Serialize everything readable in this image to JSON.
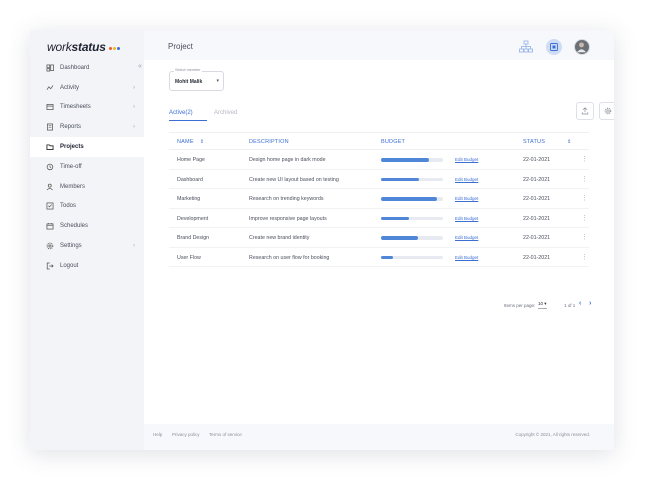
{
  "brand": {
    "name_light": "work",
    "name_bold": "status",
    "dot_colors": [
      "#f05a28",
      "#f7b718",
      "#3c6fd4"
    ]
  },
  "sidebar": {
    "items": [
      {
        "label": "Dashboard",
        "icon": "dashboard-icon",
        "active": false,
        "chevron": false
      },
      {
        "label": "Activity",
        "icon": "activity-icon",
        "active": false,
        "chevron": true
      },
      {
        "label": "Timesheets",
        "icon": "timesheet-icon",
        "active": false,
        "chevron": true
      },
      {
        "label": "Reports",
        "icon": "reports-icon",
        "active": false,
        "chevron": true
      },
      {
        "label": "Projects",
        "icon": "folder-icon",
        "active": true,
        "chevron": false
      },
      {
        "label": "Time-off",
        "icon": "history-icon",
        "active": false,
        "chevron": false
      },
      {
        "label": "Members",
        "icon": "members-icon",
        "active": false,
        "chevron": false
      },
      {
        "label": "Todos",
        "icon": "todo-icon",
        "active": false,
        "chevron": false
      },
      {
        "label": "Schedules",
        "icon": "calendar-icon",
        "active": false,
        "chevron": false
      },
      {
        "label": "Settings",
        "icon": "gear-icon",
        "active": false,
        "chevron": true
      },
      {
        "label": "Logout",
        "icon": "logout-icon",
        "active": false,
        "chevron": false
      }
    ],
    "collapse_glyph": "«"
  },
  "header": {
    "title": "Project"
  },
  "filter": {
    "label": "Select member",
    "value": "Mohit Malik"
  },
  "tabs": {
    "active": "Active(2)",
    "inactive": "Archived"
  },
  "table": {
    "headers": {
      "name": "NAME",
      "description": "DESCRIPTION",
      "budget": "BUDGET",
      "status": "STATUS"
    },
    "edit_label": "Edit Budget",
    "rows": [
      {
        "name": "Home Page",
        "description": "Design home page in dark mode",
        "budget": 0.78,
        "status": "22-01-2021"
      },
      {
        "name": "Dashboard",
        "description": "Create new UI layout based on testing",
        "budget": 0.62,
        "status": "22-01-2021"
      },
      {
        "name": "Marketing",
        "description": "Research on trending keywords",
        "budget": 0.9,
        "status": "22-01-2021"
      },
      {
        "name": "Development",
        "description": "Improve responsive page layouts",
        "budget": 0.45,
        "status": "22-01-2021"
      },
      {
        "name": "Brand Design",
        "description": "Create new brand identity",
        "budget": 0.6,
        "status": "22-01-2021"
      },
      {
        "name": "User Flow",
        "description": "Research on user flow for booking",
        "budget": 0.2,
        "status": "22-01-2021"
      }
    ]
  },
  "pagination": {
    "items_label": "Items per page:",
    "page_size": "10",
    "range": "1 of 1"
  },
  "footer": {
    "links": [
      "Help",
      "Privacy policy",
      "Terms of service"
    ],
    "copyright": "Copyright © 2021, All rights reserved."
  },
  "colors": {
    "accent": "#3c6fd4",
    "bar": "#4f86d8"
  }
}
